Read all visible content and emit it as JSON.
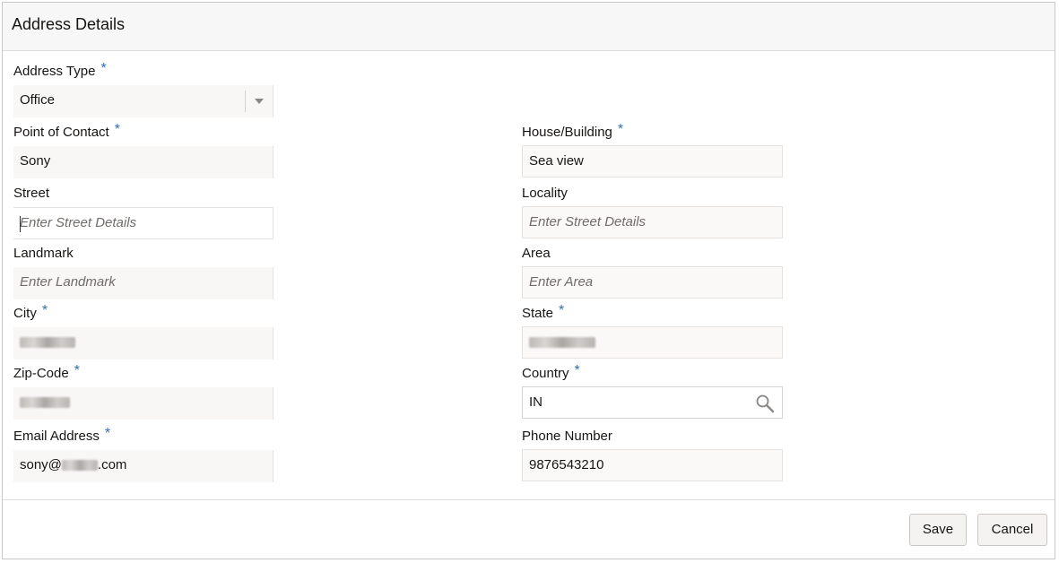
{
  "dialog": {
    "title": "Address Details"
  },
  "form": {
    "address_type": {
      "label": "Address Type",
      "value": "Office"
    },
    "point_of_contact": {
      "label": "Point of Contact",
      "value": "Sony"
    },
    "house_building": {
      "label": "House/Building",
      "value": "Sea view"
    },
    "street": {
      "label": "Street",
      "placeholder": "Enter Street Details"
    },
    "locality": {
      "label": "Locality",
      "placeholder": "Enter Street Details"
    },
    "landmark": {
      "label": "Landmark",
      "placeholder": "Enter Landmark"
    },
    "area": {
      "label": "Area",
      "placeholder": "Enter Area"
    },
    "city": {
      "label": "City",
      "value": ""
    },
    "state": {
      "label": "State",
      "value": ""
    },
    "zip_code": {
      "label": "Zip-Code",
      "value": ""
    },
    "country": {
      "label": "Country",
      "value": "IN"
    },
    "email": {
      "label": "Email Address",
      "value_prefix": "sony@",
      "value_suffix": ".com"
    },
    "phone": {
      "label": "Phone Number",
      "value": "9876543210"
    },
    "required_marker": "*"
  },
  "buttons": {
    "save": "Save",
    "cancel": "Cancel"
  },
  "icons": {
    "select_arrow": "chevron-down-icon",
    "country_lookup": "search-icon"
  },
  "colors": {
    "required": "#2f6fb7",
    "input_bg": "#faf9f8",
    "header_bg": "#f7f7f7"
  }
}
